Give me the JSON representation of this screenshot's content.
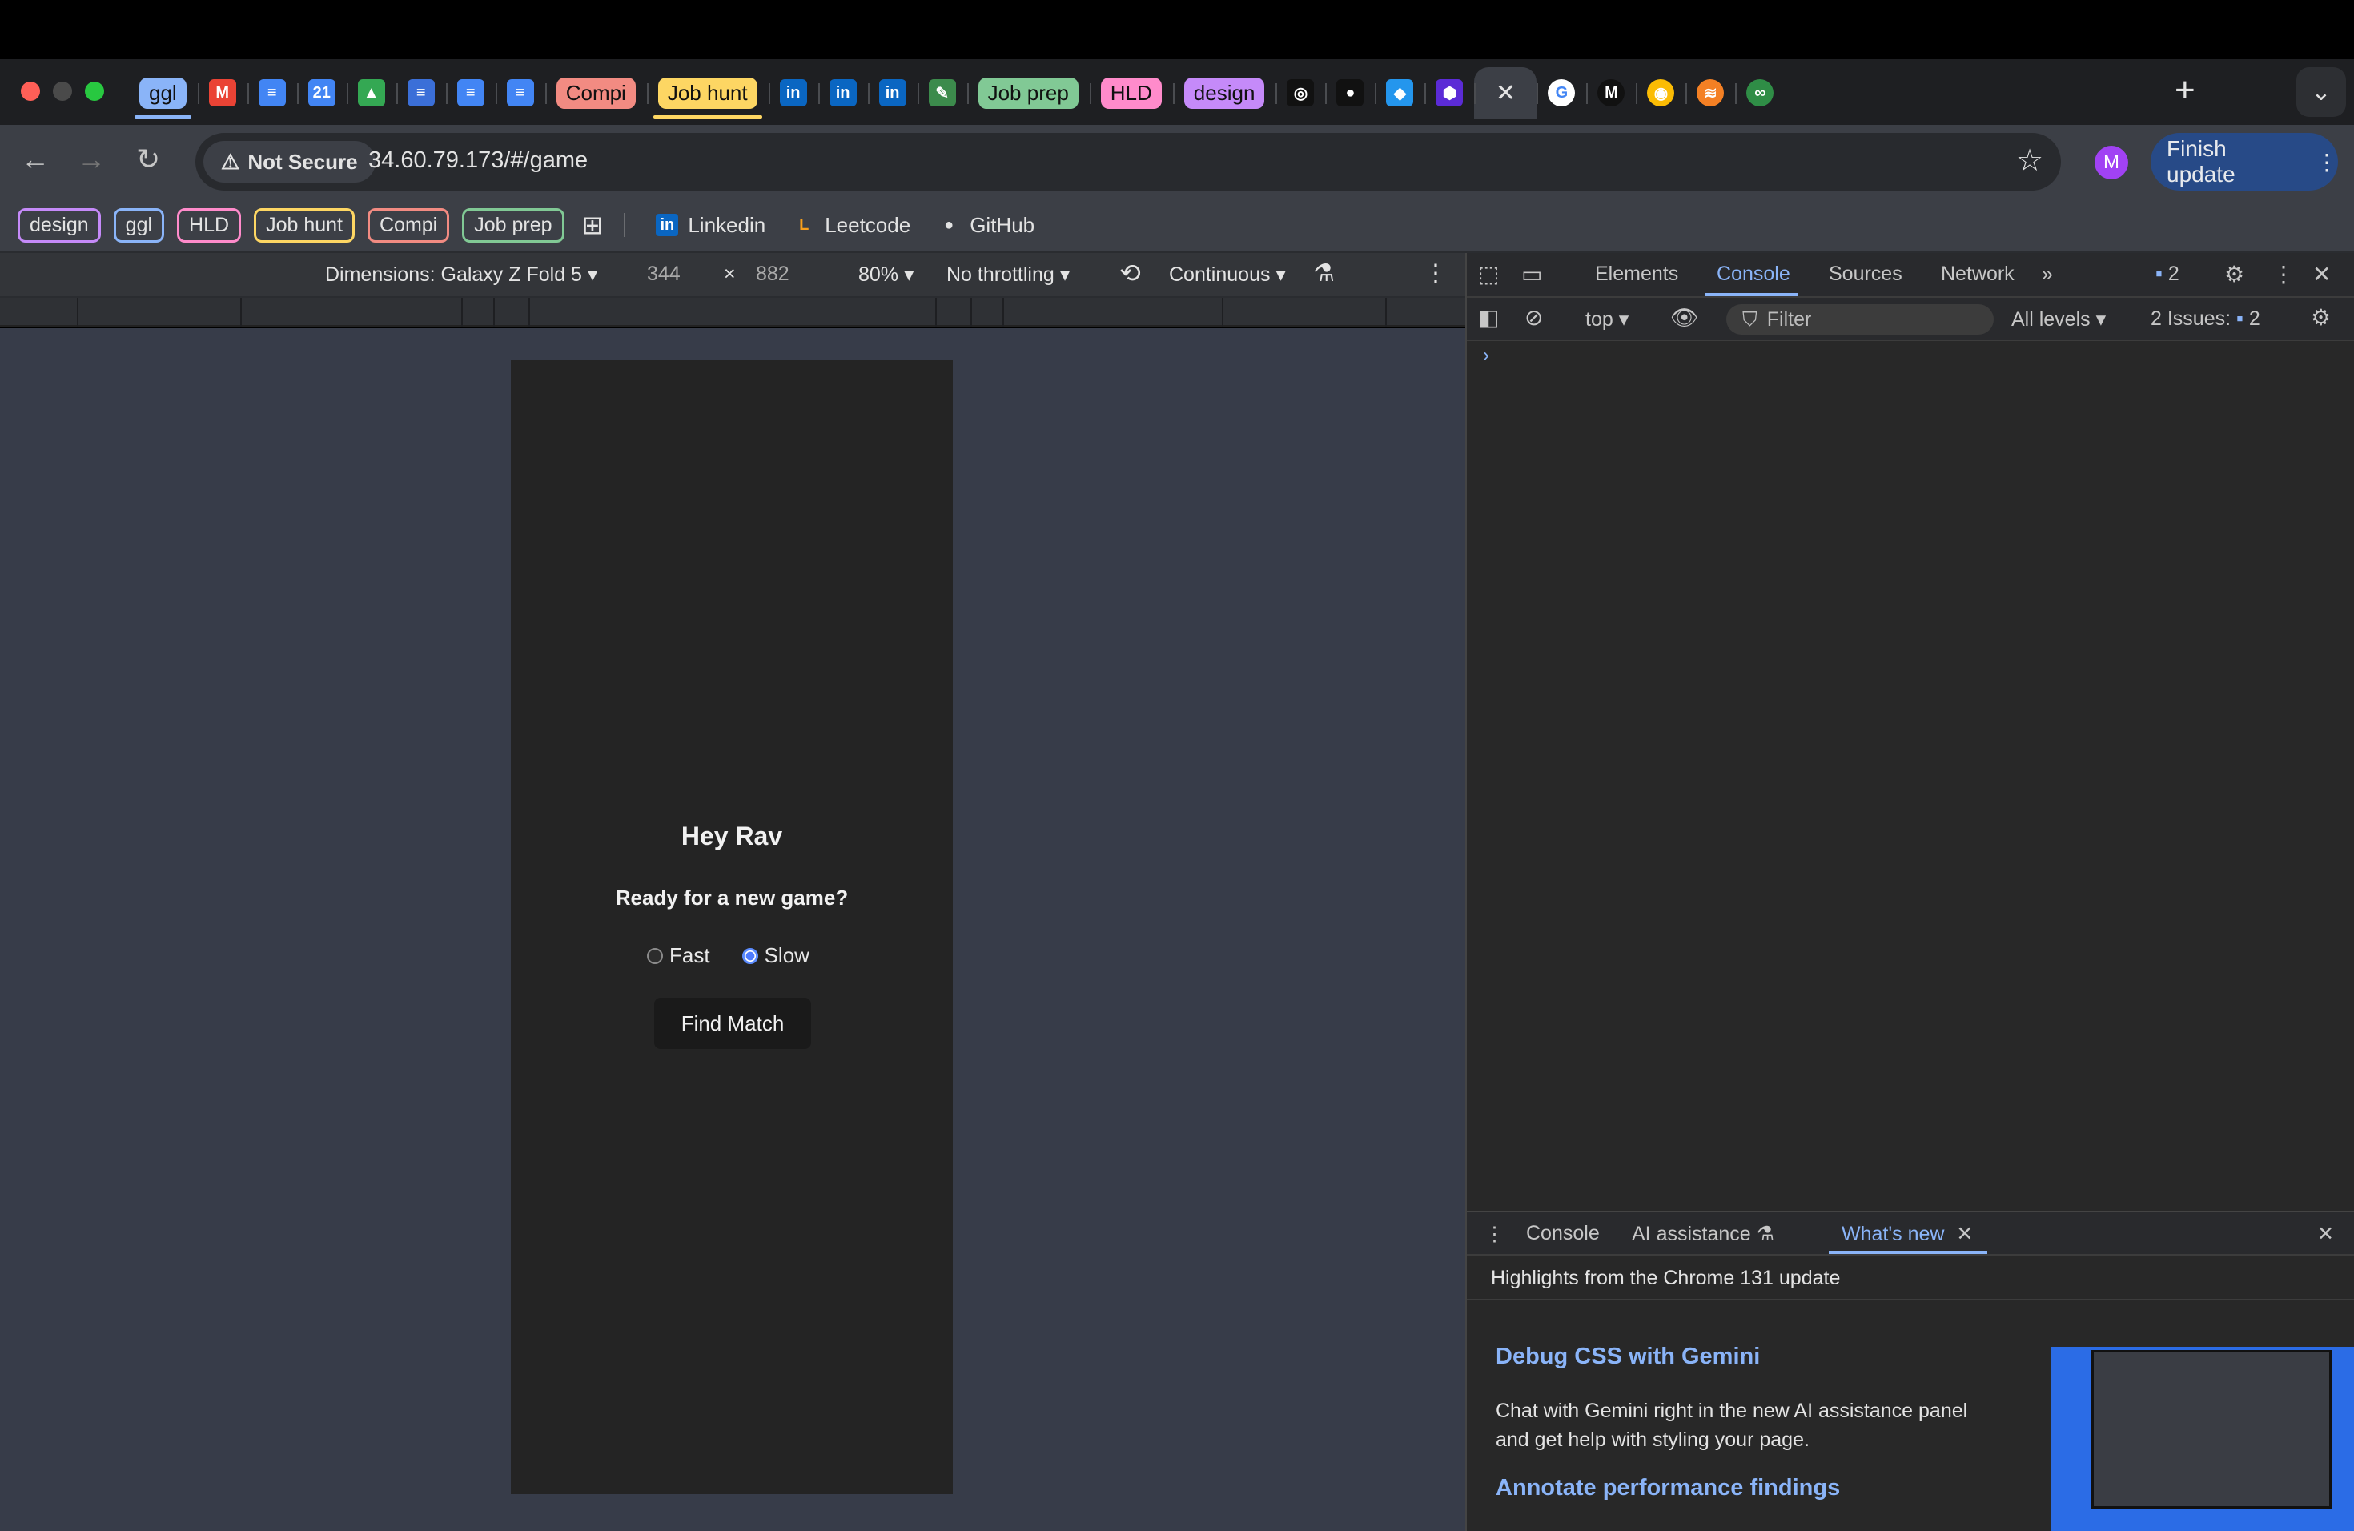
{
  "tabs": {
    "items": [
      {
        "type": "group",
        "label": "ggl",
        "color": "#8ab4f8"
      },
      {
        "type": "icon",
        "icon": "gmail-icon",
        "label": "M"
      },
      {
        "type": "icon",
        "icon": "docs-icon",
        "label": "≡"
      },
      {
        "type": "icon",
        "icon": "calendar-icon",
        "label": "21"
      },
      {
        "type": "icon",
        "icon": "drive-icon",
        "label": "▲"
      },
      {
        "type": "icon",
        "icon": "reader-icon",
        "label": "≡"
      },
      {
        "type": "icon",
        "icon": "docs-icon",
        "label": "≡"
      },
      {
        "type": "icon",
        "icon": "docs-icon",
        "label": "≡"
      },
      {
        "type": "group",
        "label": "Compi",
        "color": "#f28b82"
      },
      {
        "type": "group",
        "label": "Job hunt",
        "color": "#fdd663"
      },
      {
        "type": "icon",
        "icon": "linkedin-icon",
        "label": "in"
      },
      {
        "type": "icon",
        "icon": "linkedin-icon",
        "label": "in"
      },
      {
        "type": "icon",
        "icon": "linkedin-icon",
        "label": "in"
      },
      {
        "type": "icon",
        "icon": "leaf-icon",
        "label": "✎"
      },
      {
        "type": "group",
        "label": "Job prep",
        "color": "#81c995"
      },
      {
        "type": "group",
        "label": "HLD",
        "color": "#ff8bcb"
      },
      {
        "type": "group",
        "label": "design",
        "color": "#c58af9"
      },
      {
        "type": "icon",
        "icon": "openai-icon",
        "label": "◎"
      },
      {
        "type": "icon",
        "icon": "github-icon",
        "label": "●"
      },
      {
        "type": "icon",
        "icon": "docker-icon",
        "label": "◆"
      },
      {
        "type": "icon",
        "icon": "hex-icon",
        "label": "⬢"
      }
    ],
    "active_close": "✕",
    "after_active": [
      {
        "icon": "google-icon",
        "label": "G"
      },
      {
        "icon": "medium-icon",
        "label": "M"
      },
      {
        "icon": "chrome-icon",
        "label": "◉"
      },
      {
        "icon": "stackoverflow-icon",
        "label": "≋"
      },
      {
        "icon": "geeksforgeeks-icon",
        "label": "∞"
      }
    ],
    "new_tab": "+",
    "menu": "⌄"
  },
  "toolbar": {
    "back": "←",
    "forward": "→",
    "reload": "↻",
    "security_label": "Not Secure",
    "url": "34.60.79.173/#/game",
    "star": "☆",
    "avatar_letter": "M",
    "finish_update": "Finish update",
    "more": "⋮"
  },
  "bookmarks": {
    "groups": [
      {
        "label": "design",
        "color": "#c58af9"
      },
      {
        "label": "ggl",
        "color": "#8ab4f8"
      },
      {
        "label": "HLD",
        "color": "#ff8bcb"
      },
      {
        "label": "Job hunt",
        "color": "#fdd663"
      },
      {
        "label": "Compi",
        "color": "#f28b82"
      },
      {
        "label": "Job prep",
        "color": "#81c995"
      }
    ],
    "links": [
      {
        "label": "Linkedin",
        "icon": "linkedin-icon"
      },
      {
        "label": "Leetcode",
        "icon": "leetcode-icon"
      },
      {
        "label": "GitHub",
        "icon": "github-icon"
      }
    ]
  },
  "device_toolbar": {
    "dimensions": "Dimensions: Galaxy Z Fold 5",
    "width": "344",
    "times": "×",
    "height": "882",
    "zoom": "80%",
    "throttling": "No throttling",
    "mode": "Continuous"
  },
  "app": {
    "greeting": "Hey Rav",
    "prompt": "Ready for a new game?",
    "options": [
      {
        "label": "Fast",
        "selected": false
      },
      {
        "label": "Slow",
        "selected": true
      }
    ],
    "find_match": "Find Match"
  },
  "devtools": {
    "tabs": [
      "Elements",
      "Console",
      "Sources",
      "Network"
    ],
    "active_tab": "Console",
    "more_tabs": "»",
    "issues_badge": "2",
    "context": "top",
    "filter_placeholder": "Filter",
    "levels": "All levels",
    "issues_label": "2 Issues:",
    "issues_count": "2",
    "console_prompt": "›"
  },
  "drawer": {
    "tabs": [
      "Console",
      "AI assistance",
      "What's new"
    ],
    "active_tab": "What's new",
    "highlights": "Highlights from the Chrome 131 update",
    "features": [
      {
        "title": "Debug CSS with Gemini",
        "desc": "Chat with Gemini right in the new AI assistance panel and get help with styling your page."
      },
      {
        "title": "Annotate performance findings"
      }
    ]
  },
  "colors": {
    "viewport_bg": "#373c49",
    "phone_bg": "#242424",
    "accent": "#8ab4f8"
  }
}
